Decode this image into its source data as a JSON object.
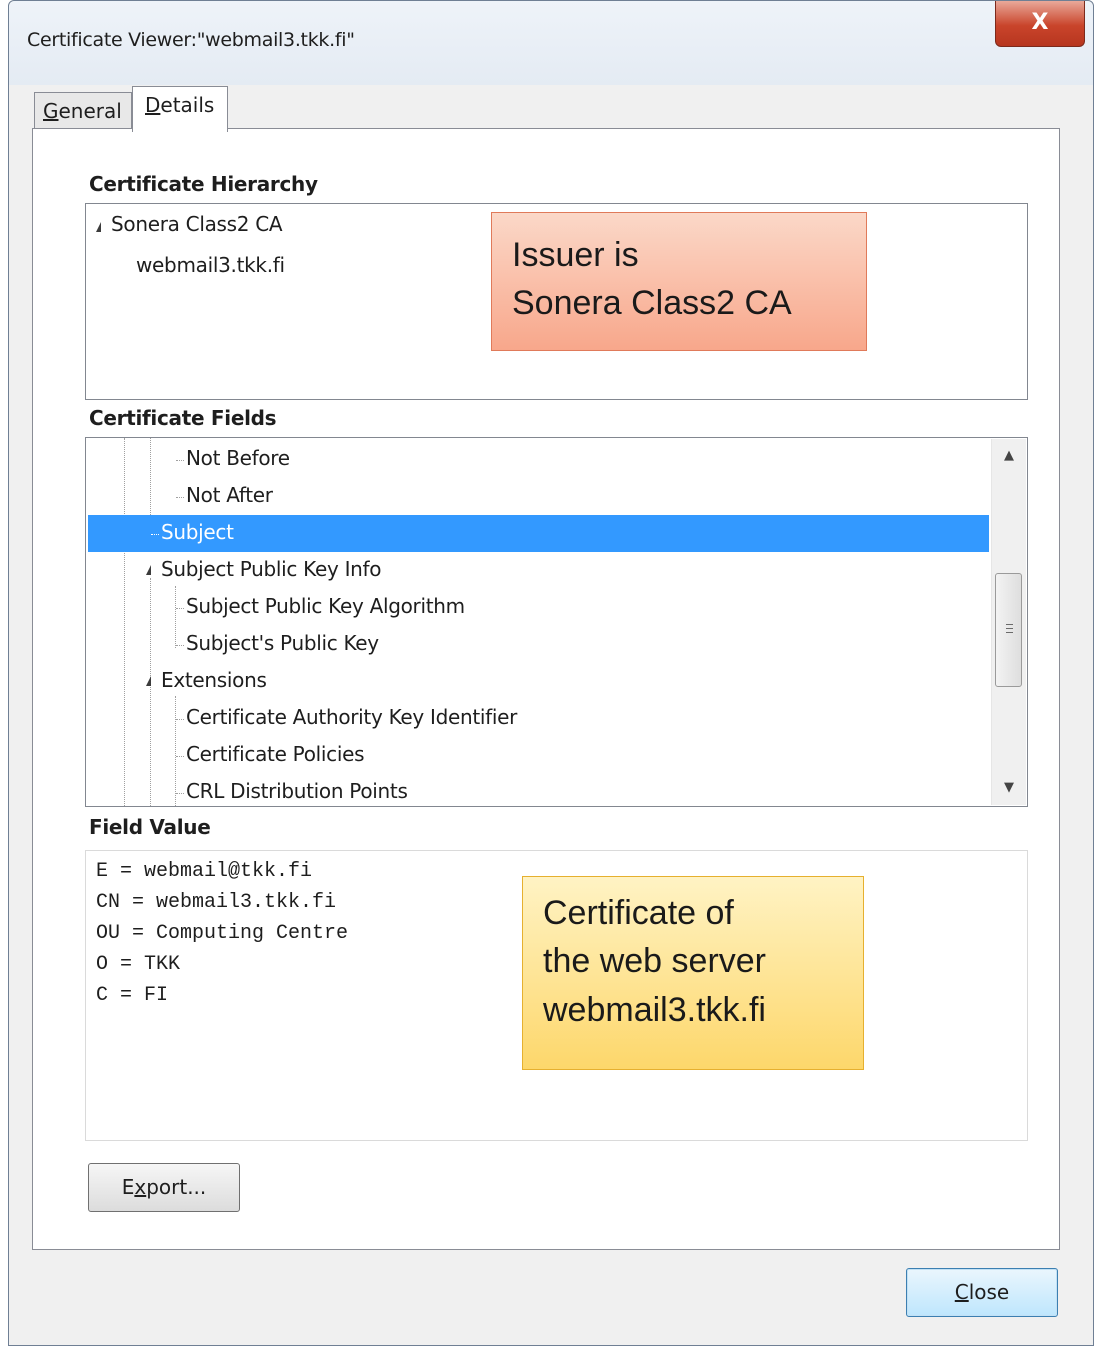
{
  "window": {
    "title": "Certificate Viewer:\"webmail3.tkk.fi\"",
    "close_glyph": "X"
  },
  "tabs": [
    {
      "label": "General",
      "accel": "G",
      "rest": "eneral"
    },
    {
      "label": "Details",
      "accel": "D",
      "rest": "etails"
    }
  ],
  "hierarchy": {
    "label": "Certificate Hierarchy",
    "items": [
      "Sonera Class2 CA",
      "webmail3.tkk.fi"
    ]
  },
  "fields": {
    "label": "Certificate Fields",
    "items": [
      "Not Before",
      "Not After",
      "Subject",
      "Subject Public Key Info",
      "Subject Public Key Algorithm",
      "Subject's Public Key",
      "Extensions",
      "Certificate Authority Key Identifier",
      "Certificate Policies",
      "CRL Distribution Points"
    ],
    "selected": "Subject"
  },
  "field_value": {
    "label": "Field Value",
    "lines": [
      "E = webmail@tkk.fi",
      "CN = webmail3.tkk.fi",
      "OU = Computing Centre",
      "O = TKK",
      "C = FI"
    ]
  },
  "callouts": {
    "issuer": [
      "Issuer is",
      "Sonera Class2 CA"
    ],
    "certificate": [
      "Certificate of",
      "the web server",
      "webmail3.tkk.fi"
    ]
  },
  "buttons": {
    "export": {
      "label": "Export...",
      "accel": "x",
      "pre": "E",
      "post": "port..."
    },
    "close": {
      "label": "Close",
      "accel": "C",
      "post": "lose"
    }
  },
  "colors": {
    "selection": "#3399ff",
    "issuer_callout": "#f8a78b",
    "cert_callout": "#fdd76b"
  }
}
